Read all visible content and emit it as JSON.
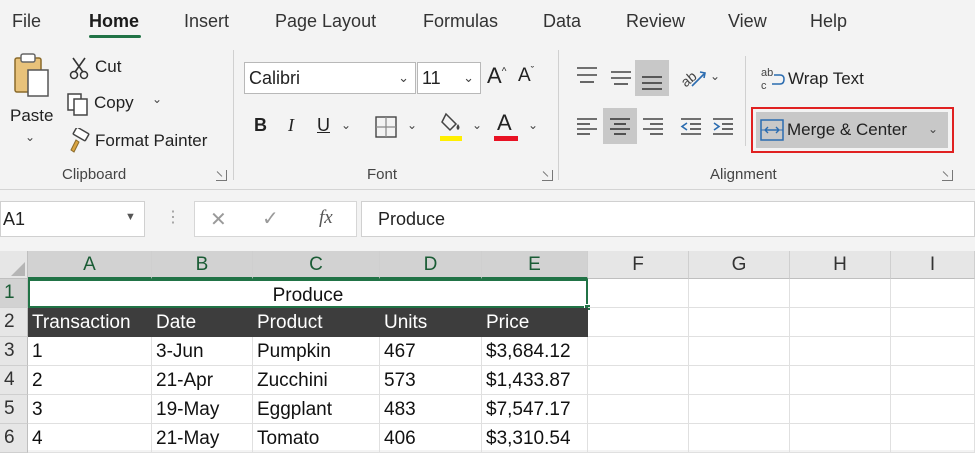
{
  "tabs": [
    "File",
    "Home",
    "Insert",
    "Page Layout",
    "Formulas",
    "Data",
    "Review",
    "View",
    "Help"
  ],
  "clipboard": {
    "paste_label": "Paste",
    "cut_label": "Cut",
    "copy_label": "Copy",
    "format_painter_label": "Format Painter",
    "group_label": "Clipboard"
  },
  "font": {
    "font_name": "Calibri",
    "font_size": "11",
    "bold": "B",
    "italic": "I",
    "underline": "U",
    "group_label": "Font",
    "font_color": "#e81123",
    "highlight_color": "#ffef00"
  },
  "alignment": {
    "wrap_text_label": "Wrap Text",
    "merge_center_label": "Merge & Center",
    "group_label": "Alignment",
    "highlight_border_color": "#e02020"
  },
  "formula_bar": {
    "name_box": "A1",
    "fx_label": "fx",
    "formula_value": "Produce"
  },
  "grid": {
    "columns": [
      "A",
      "B",
      "C",
      "D",
      "E",
      "F",
      "G",
      "H",
      "I"
    ],
    "rows": [
      "1",
      "2",
      "3",
      "4",
      "5",
      "6"
    ],
    "title": "Produce",
    "headers": [
      "Transaction",
      "Date",
      "Product",
      "Units",
      "Price"
    ],
    "data": [
      [
        "1",
        "3-Jun",
        "Pumpkin",
        "467",
        "$3,684.12"
      ],
      [
        "2",
        "21-Apr",
        "Zucchini",
        "573",
        "$1,433.87"
      ],
      [
        "3",
        "19-May",
        "Eggplant",
        "483",
        "$7,547.17"
      ],
      [
        "4",
        "21-May",
        "Tomato",
        "406",
        "$3,310.54"
      ]
    ]
  }
}
